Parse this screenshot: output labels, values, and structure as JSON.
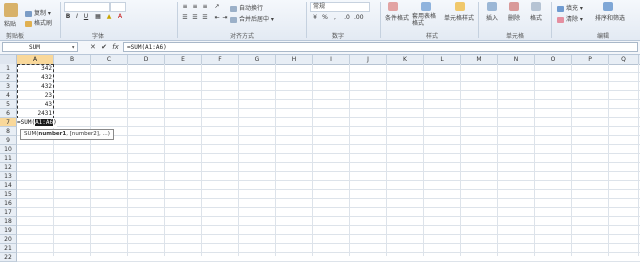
{
  "ribbon": {
    "clipboard": {
      "paste": "粘贴",
      "copy": "复制",
      "format_painter": "格式刷",
      "group": "剪贴板"
    },
    "font": {
      "group": "字体"
    },
    "alignment": {
      "wrap": "自动换行",
      "merge": "合并后居中",
      "group": "对齐方式"
    },
    "number": {
      "format": "常规",
      "group": "数字"
    },
    "styles": {
      "cond_format": "条件格式",
      "table_format": "套用表格格式",
      "cell_style": "单元格样式",
      "group": "样式"
    },
    "cells": {
      "insert": "插入",
      "delete": "删除",
      "format": "格式",
      "group": "单元格"
    },
    "editing": {
      "fill": "填充",
      "clear": "清除",
      "sort": "排序和筛选",
      "group": "编辑"
    }
  },
  "formula_bar": {
    "name_box": "SUM",
    "cancel_icon": "✕",
    "enter_icon": "✔",
    "fx": "fx",
    "formula": "=SUM(A1:A6)"
  },
  "columns": [
    "A",
    "B",
    "C",
    "D",
    "E",
    "F",
    "G",
    "H",
    "I",
    "J",
    "K",
    "L",
    "M",
    "N",
    "O",
    "P",
    "Q"
  ],
  "rows": [
    "1",
    "2",
    "3",
    "4",
    "5",
    "6",
    "7",
    "8",
    "9",
    "10",
    "11",
    "12",
    "13",
    "14",
    "15",
    "16",
    "17",
    "18",
    "19",
    "20",
    "21",
    "22"
  ],
  "cells": {
    "A1": "342",
    "A2": "432",
    "A3": "432",
    "A4": "23",
    "A5": "43",
    "A6": "2431",
    "A7_prefix": "=SUM(",
    "A7_ref": "A1:A6",
    "A7_suffix": ")"
  },
  "tooltip": {
    "func": "SUM(",
    "arg1": "number1",
    "rest": ", [number2], ...)"
  },
  "colors": {
    "accent": "#1a1a1a",
    "header_selected": "#f9d89a",
    "ribbon": "#e3eaf3"
  }
}
